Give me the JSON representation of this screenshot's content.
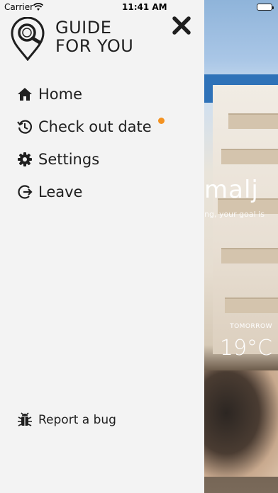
{
  "status_bar": {
    "carrier": "Carrier",
    "time": "11:41 AM"
  },
  "drawer": {
    "brand_line1": "GUIDE",
    "brand_line2": "FOR YOU",
    "menu": [
      {
        "label": "Home",
        "icon": "home-icon"
      },
      {
        "label": "Check out date",
        "icon": "clock-icon",
        "badge": true
      },
      {
        "label": "Settings",
        "icon": "gear-icon"
      },
      {
        "label": "Leave",
        "icon": "logout-icon"
      }
    ],
    "report_bug": "Report a bug",
    "accent_color": "#f39221"
  },
  "background": {
    "title": "malj",
    "subtitle": "ng, your goal is",
    "weather_label": "TOMORROW",
    "temperature": "19°C"
  }
}
